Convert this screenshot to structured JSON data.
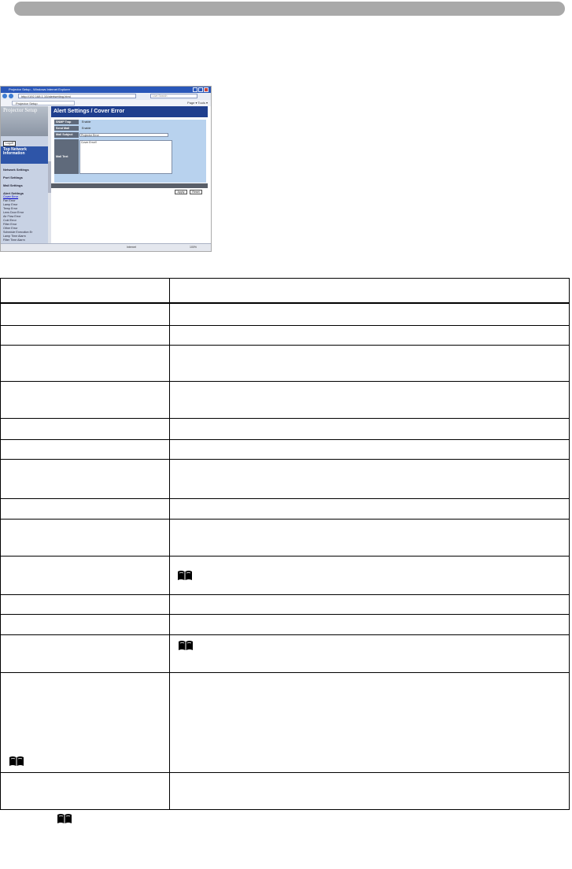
{
  "screenshot": {
    "window_title": "Projector Setup - Windows Internet Explorer",
    "url": "http://192.168.1.10/alertsetting.html",
    "search_placeholder": "Live Search",
    "tab_label": "Projector Setup",
    "toolbar_tools": "Page ▾  Tools ▾",
    "logo": "Projector Setup",
    "logout_label": "Logoff",
    "top_network_label": "Top Network Information",
    "nav_items": [
      "Network Settings",
      "Port Settings",
      "Mail Settings",
      "Alert Settings"
    ],
    "alert_items": [
      "Cover Error",
      "Fan Error",
      "Lamp Error",
      "Temp Error",
      "Lens Door Error",
      "Air Flow Error",
      "Cold Error",
      "Filter Error",
      "Other Error",
      "Schedule Execution Er",
      "Lamp Time Alarm",
      "Filter Time Alarm"
    ],
    "page_title": "Alert Settings / Cover Error",
    "form": {
      "snmp_label": "SNMP Trap",
      "snmp_value": "Enable",
      "send_mail_label": "Send Mail",
      "send_mail_value": "Enable",
      "mail_subject_label": "Mail Subject",
      "mail_subject_value": "Projector Error",
      "mail_text_label": "Mail Text",
      "mail_text_value": "Cover Error!!"
    },
    "apply_label": "Apply",
    "reset_label": "Reset",
    "status_zone": "Internet",
    "status_zoom": "100%"
  },
  "table": {
    "rows": 18
  },
  "icons": [
    "book-icon",
    "book-icon",
    "book-icon",
    "book-icon"
  ]
}
